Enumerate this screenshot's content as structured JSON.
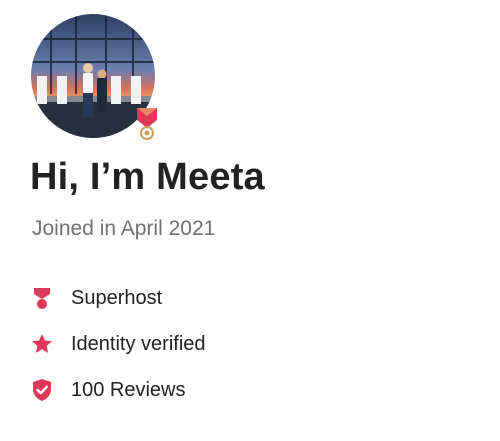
{
  "status_bar": {
    "time_fragment": ""
  },
  "profile": {
    "title": "Hi, I’m Meeta",
    "joined": "Joined in April 2021"
  },
  "badges": [
    {
      "icon": "superhost-icon",
      "label": "Superhost"
    },
    {
      "icon": "star-icon",
      "label": "Identity verified"
    },
    {
      "icon": "shield-check-icon",
      "label": "100 Reviews"
    }
  ],
  "colors": {
    "accent": "#E0385A",
    "text": "#222222",
    "muted": "#717171"
  }
}
